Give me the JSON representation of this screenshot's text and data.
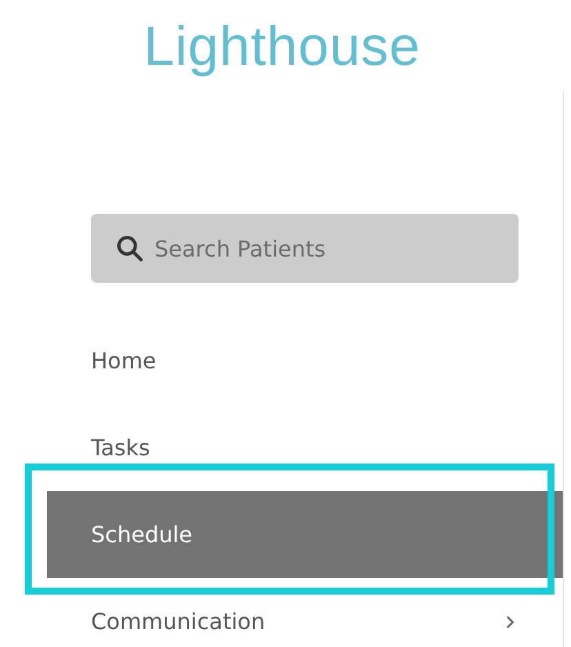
{
  "logo": {
    "text": "Lighthouse"
  },
  "search": {
    "placeholder": "Search Patients"
  },
  "nav": [
    {
      "label": "Home",
      "selected": false,
      "has_submenu": false
    },
    {
      "label": "Tasks",
      "selected": false,
      "has_submenu": false
    },
    {
      "label": "Schedule",
      "selected": true,
      "has_submenu": false
    },
    {
      "label": "Communication",
      "selected": false,
      "has_submenu": true
    }
  ]
}
